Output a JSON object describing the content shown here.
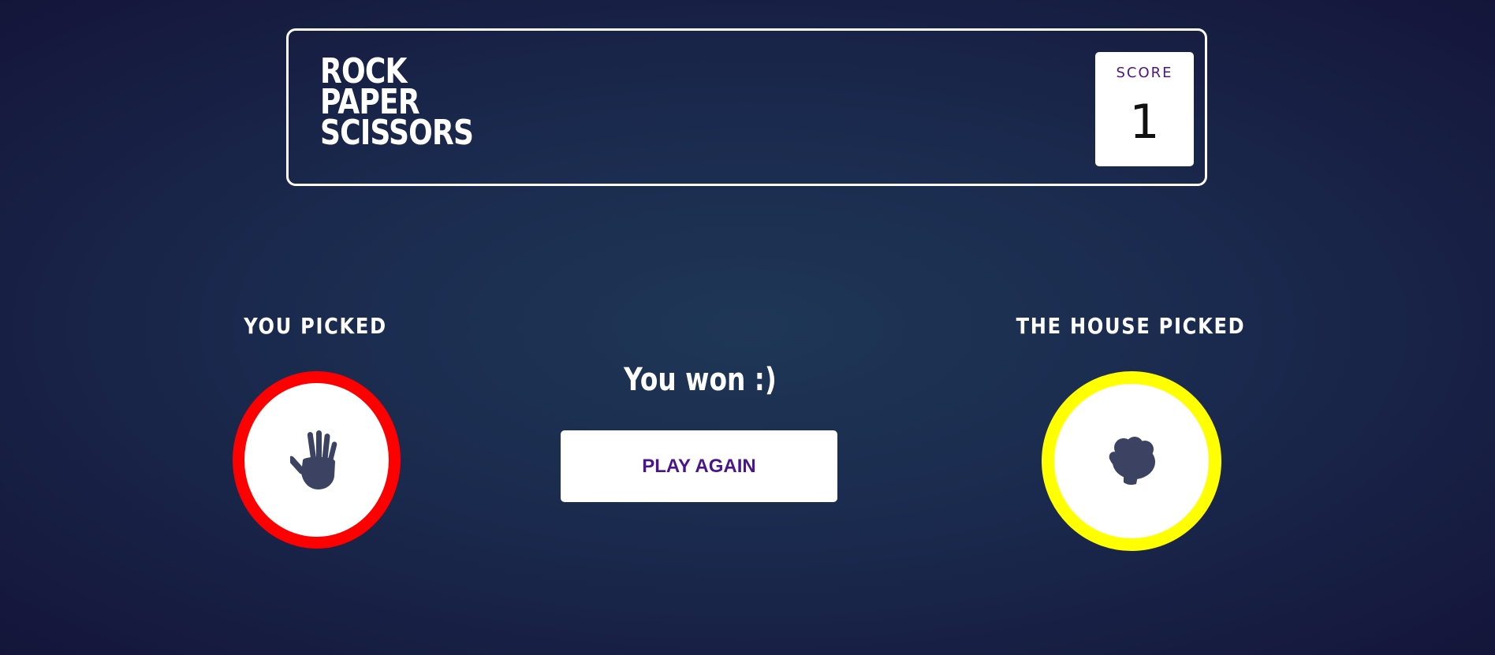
{
  "header": {
    "title_lines": [
      "ROCK",
      "PAPER",
      "SCISSORS"
    ],
    "score_label": "SCORE",
    "score_value": "1"
  },
  "player": {
    "label": "YOU PICKED",
    "choice_icon": "paper-hand-icon",
    "ring_color": "#ff0000"
  },
  "house": {
    "label": "THE HOUSE PICKED",
    "choice_icon": "rock-fist-icon",
    "ring_color": "#ffff00"
  },
  "result": {
    "message": "You won :)",
    "play_again_label": "PLAY AGAIN"
  },
  "colors": {
    "accent_text": "#4a148c",
    "icon_fill": "#3b4262",
    "background": "#1f3756"
  }
}
